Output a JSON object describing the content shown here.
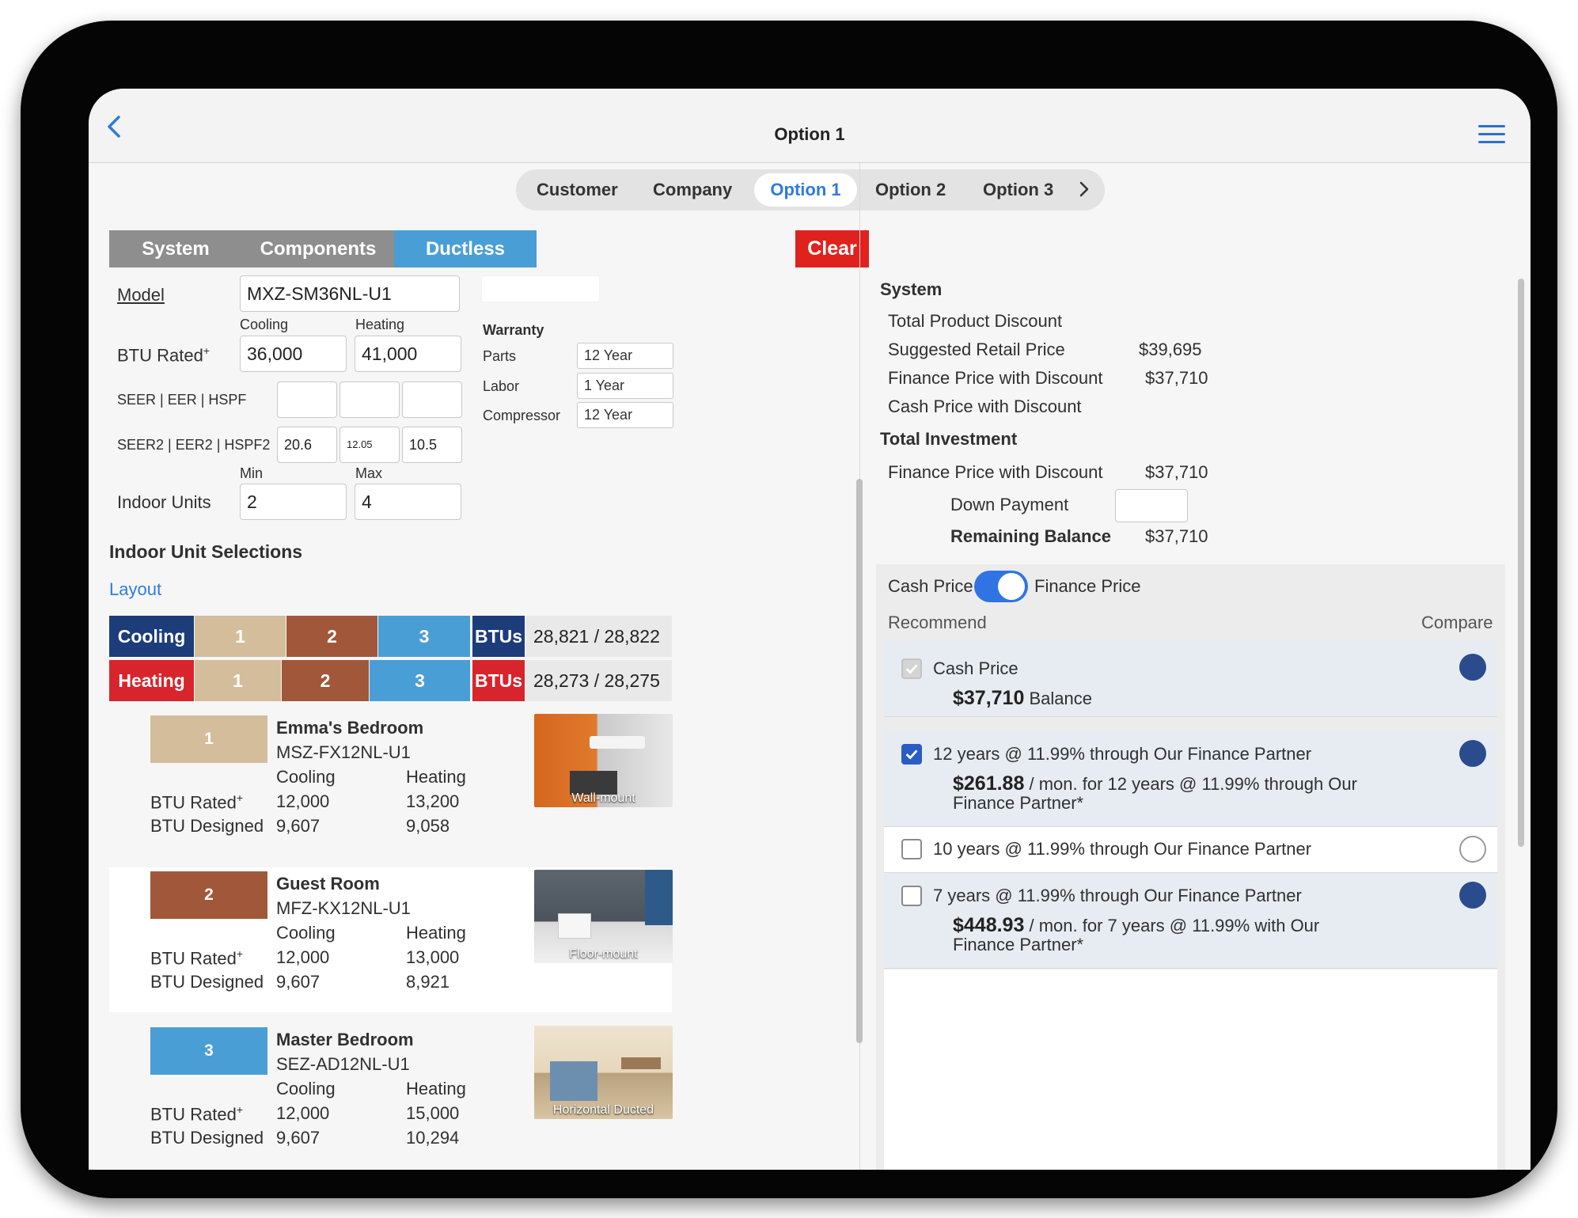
{
  "nav": {
    "title": "Option 1"
  },
  "tabs": [
    "Customer",
    "Company",
    "Option 1",
    "Option 2",
    "Option 3"
  ],
  "segments": [
    "System",
    "Components",
    "Ductless"
  ],
  "clear_label": "Clear",
  "system": {
    "model_label": "Model",
    "model_value": "MXZ-SM36NL-U1",
    "cooling_label": "Cooling",
    "heating_label": "Heating",
    "btu_rated_label": "BTU Rated",
    "btu_cooling": "36,000",
    "btu_heating": "41,000",
    "seer_label": "SEER | EER | HSPF",
    "seer2_label": "SEER2 | EER2 | HSPF2",
    "seer2_values": [
      "20.6",
      "12.05",
      "10.5"
    ],
    "min_label": "Min",
    "max_label": "Max",
    "indoor_units_label": "Indoor Units",
    "indoor_min": "2",
    "indoor_max": "4"
  },
  "warranty": {
    "title": "Warranty",
    "rows": [
      {
        "label": "Parts",
        "value": "12 Year"
      },
      {
        "label": "Labor",
        "value": "1 Year"
      },
      {
        "label": "Compressor",
        "value": "12 Year"
      }
    ]
  },
  "indoor_selection": {
    "title": "Indoor Unit Selections",
    "layout_link": "Layout",
    "cooling_label": "Cooling",
    "heating_label": "Heating",
    "btus_label": "BTUs",
    "cooling_btus": "28,821 / 28,822",
    "heating_btus": "28,273 / 28,275",
    "segment_labels": [
      "1",
      "2",
      "3"
    ]
  },
  "units": [
    {
      "number": "1",
      "room": "Emma's Bedroom",
      "model": "MSZ-FX12NL-U1",
      "cooling": "Cooling",
      "heating": "Heating",
      "rated_label": "BTU Rated",
      "designed_label": "BTU Designed",
      "rated_cooling": "12,000",
      "rated_heating": "13,200",
      "designed_cooling": "9,607",
      "designed_heating": "9,058",
      "photo": "Wall-mount"
    },
    {
      "number": "2",
      "room": "Guest Room",
      "model": "MFZ-KX12NL-U1",
      "cooling": "Cooling",
      "heating": "Heating",
      "rated_label": "BTU Rated",
      "designed_label": "BTU Designed",
      "rated_cooling": "12,000",
      "rated_heating": "13,000",
      "designed_cooling": "9,607",
      "designed_heating": "8,921",
      "photo": "Floor-mount"
    },
    {
      "number": "3",
      "room": "Master Bedroom",
      "model": "SEZ-AD12NL-U1",
      "cooling": "Cooling",
      "heating": "Heating",
      "rated_label": "BTU Rated",
      "designed_label": "BTU Designed",
      "rated_cooling": "12,000",
      "rated_heating": "15,000",
      "designed_cooling": "9,607",
      "designed_heating": "10,294",
      "photo": "Horizontal Ducted"
    }
  ],
  "summary": {
    "system_title": "System",
    "rows": [
      {
        "label": "Total Product Discount",
        "value": ""
      },
      {
        "label": "Suggested Retail Price",
        "value": "$39,695"
      },
      {
        "label": "Finance Price with Discount",
        "value": "$37,710"
      },
      {
        "label": "Cash Price with Discount",
        "value": ""
      }
    ],
    "investment_title": "Total Investment",
    "finance_label": "Finance Price with Discount",
    "finance_value": "$37,710",
    "down_label": "Down Payment",
    "remaining_label": "Remaining Balance",
    "remaining_value": "$37,710"
  },
  "pricing": {
    "cash_label": "Cash Price",
    "finance_label": "Finance Price",
    "toggle_on": true,
    "recommend_label": "Recommend",
    "compare_label": "Compare",
    "options": [
      {
        "title": "Cash Price",
        "amount": "$37,710",
        "detail": "Balance",
        "detail2": ""
      },
      {
        "title": "12 years @ 11.99% through Our Finance Partner",
        "amount": "$261.88",
        "detail": "/ mon. for 12 years @ 11.99% through Our",
        "detail2": "Finance Partner*"
      },
      {
        "title": "10 years @ 11.99% through Our Finance Partner",
        "amount": "",
        "detail": "",
        "detail2": ""
      },
      {
        "title": "7 years @ 11.99% through Our Finance Partner",
        "amount": "$448.93",
        "detail": "/ mon. for 7 years @ 11.99% with Our",
        "detail2": "Finance Partner*"
      }
    ]
  },
  "colors": {
    "accent": "#2e7be0",
    "danger": "#e0221f",
    "cooling": "#1d3c7a",
    "heating": "#d8242c",
    "unit1": "#d3bd9b",
    "unit2": "#a1573a",
    "unit3": "#4a9ed6",
    "segment_grey": "#8e8e8e",
    "segment_active": "#4a9ed6"
  },
  "icons": [
    "chevron-left-icon",
    "hamburger-menu-icon",
    "chevron-right-icon",
    "checkmark-icon"
  ]
}
